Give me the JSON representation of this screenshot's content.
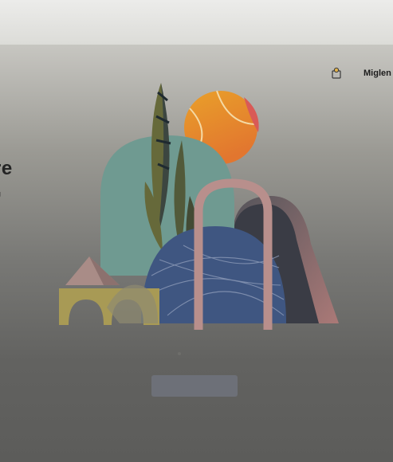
{
  "header": {
    "user_name": "Miglen",
    "user_icon": "person-icon"
  },
  "hero": {
    "heading": "re",
    "subtext": "g"
  },
  "illustration": {
    "icon": "abstract-illustration",
    "colors": {
      "sun_top": "#e9a02a",
      "sun_bottom": "#e2762f",
      "leaf_dark": "#3c4640",
      "leaf_olive": "#66693a",
      "arch_teal": "#6f9a91",
      "arch_rose": "#b67c7a",
      "sphere_blue": "#3f5681",
      "arch_yellow": "#a89a55",
      "pyramid_pink": "#a98c87"
    }
  },
  "footer": {
    "button_label": ""
  }
}
